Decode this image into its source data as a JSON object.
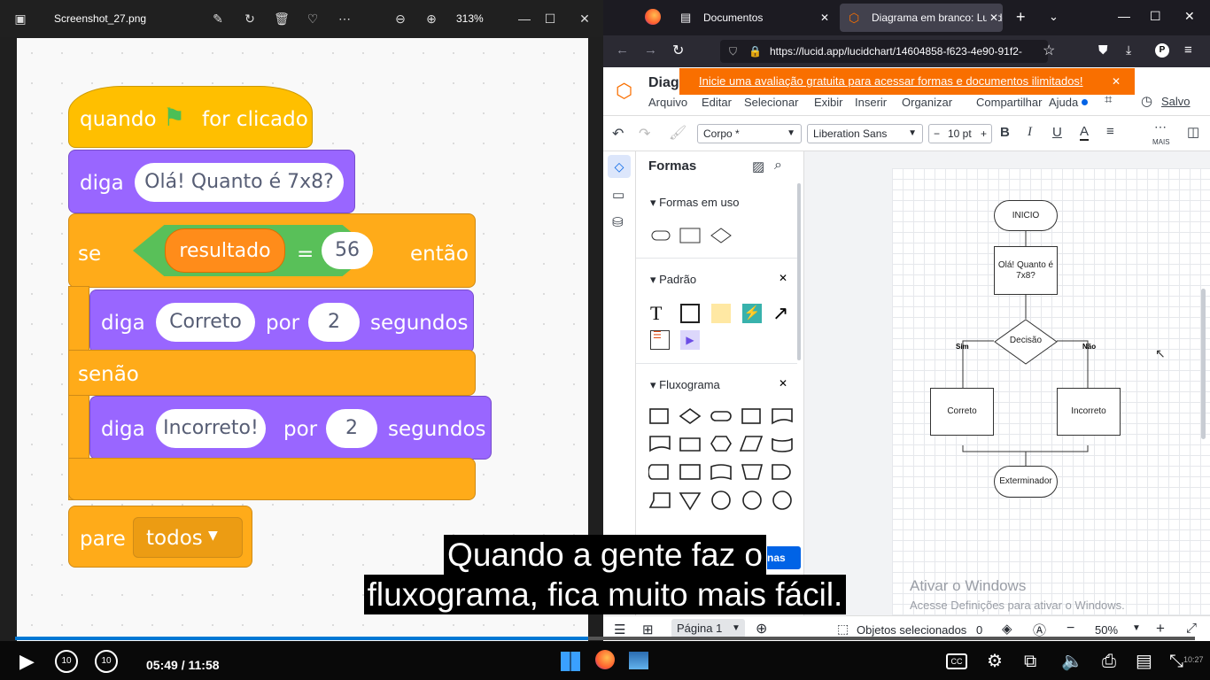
{
  "photos": {
    "filename": "Screenshot_27.png",
    "zoom": "313%"
  },
  "scratch": {
    "hat": {
      "when": "quando",
      "clicked": "for clicado"
    },
    "say1": {
      "label": "diga",
      "text": "Olá! Quanto é 7x8?"
    },
    "if": {
      "label": "se",
      "var": "resultado",
      "op": "=",
      "value": "56",
      "then": "então"
    },
    "say2": {
      "label": "diga",
      "text": "Correto",
      "for": "por",
      "secs": "2",
      "unit": "segundos"
    },
    "else": "senão",
    "say3": {
      "label": "diga",
      "text": "Incorreto!",
      "for": "por",
      "secs": "2",
      "unit": "segundos"
    },
    "stop": {
      "label": "pare",
      "option": "todos"
    }
  },
  "browser": {
    "tab1": "Documentos",
    "tab2": "Diagrama em branco: Lucidch",
    "url": "https://lucid.app/lucidchart/14604858-f623-4e90-91f2-"
  },
  "lucid": {
    "doc_title": "Diag",
    "banner": "Inicie uma avaliação gratuita para acessar formas e documentos ilimitados!",
    "menus": [
      "Arquivo",
      "Editar",
      "Selecionar",
      "Exibir",
      "Inserir",
      "Organizar",
      "Compartilhar",
      "Ajuda"
    ],
    "saved": "Salvo",
    "style": "Corpo *",
    "font": "Liberation Sans",
    "font_size": "10 pt",
    "more": "MAIS",
    "shapes_title": "Formas",
    "sect1": "Formas em uso",
    "sect2": "Padrão",
    "sect3": "Fluxograma",
    "shapes_button_partial": "nas",
    "page": "Página 1",
    "selected_label": "Objetos selecionados",
    "selected_count": "0",
    "zoom": "50%",
    "flow": {
      "start": "INICIO",
      "ask": "Olá! Quanto é 7x8?",
      "decision": "Decisão",
      "yes": "Sim",
      "no": "Não",
      "right": "Correto",
      "wrong": "Incorreto",
      "end": "Exterminador"
    },
    "watermark1": "Ativar o Windows",
    "watermark2": "Acesse Definições para ativar o Windows."
  },
  "video": {
    "time": "05:49 / 11:58",
    "progress": 0.486,
    "skip_back": "10",
    "skip_fwd": "10",
    "subtitle1": "Quando a gente faz o",
    "subtitle2": "fluxograma, fica muito mais fácil.",
    "clock": "10:27"
  }
}
